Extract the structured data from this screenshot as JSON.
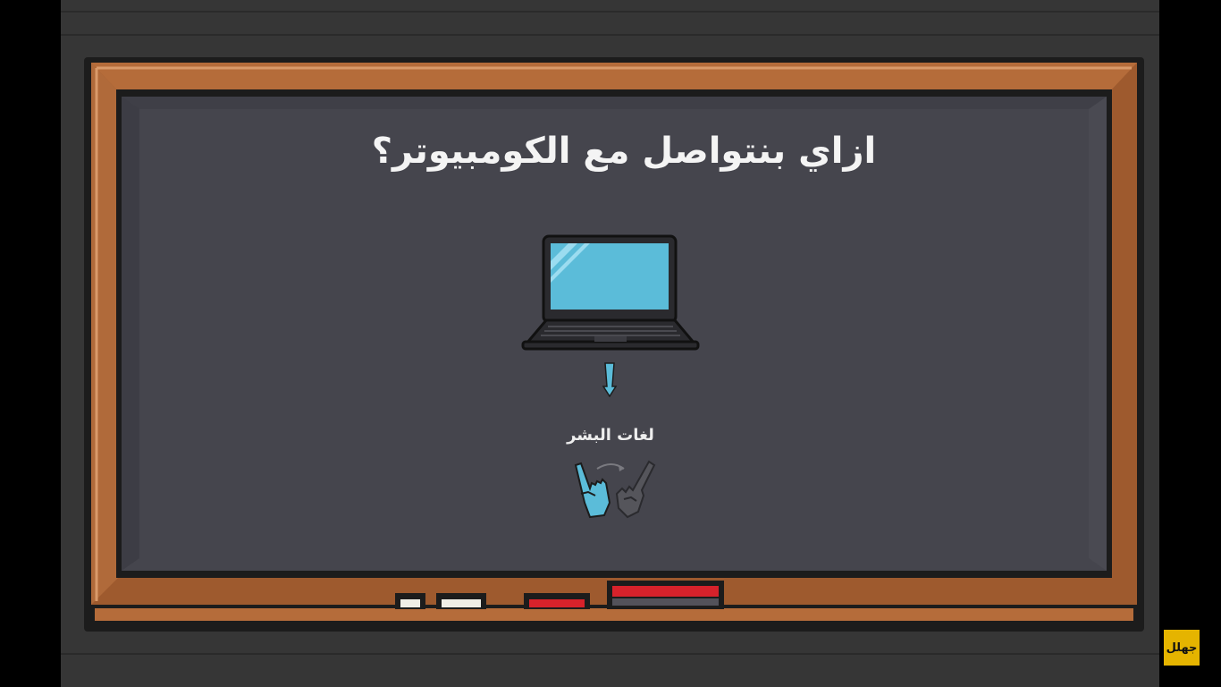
{
  "lesson": {
    "title": "ازاي بنتواصل مع الكومبيوتر؟",
    "human_languages_label": "لغات البشر"
  },
  "icons": {
    "laptop": "laptop-icon",
    "arrow": "down-arrow-icon",
    "hands": "sign-language-hands-icon"
  },
  "channel": {
    "logo_text": "جهلل"
  },
  "colors": {
    "board": "#46464e",
    "frame": "#a05c30",
    "screen": "#5bbcd9",
    "logo_bg": "#e5b400"
  }
}
